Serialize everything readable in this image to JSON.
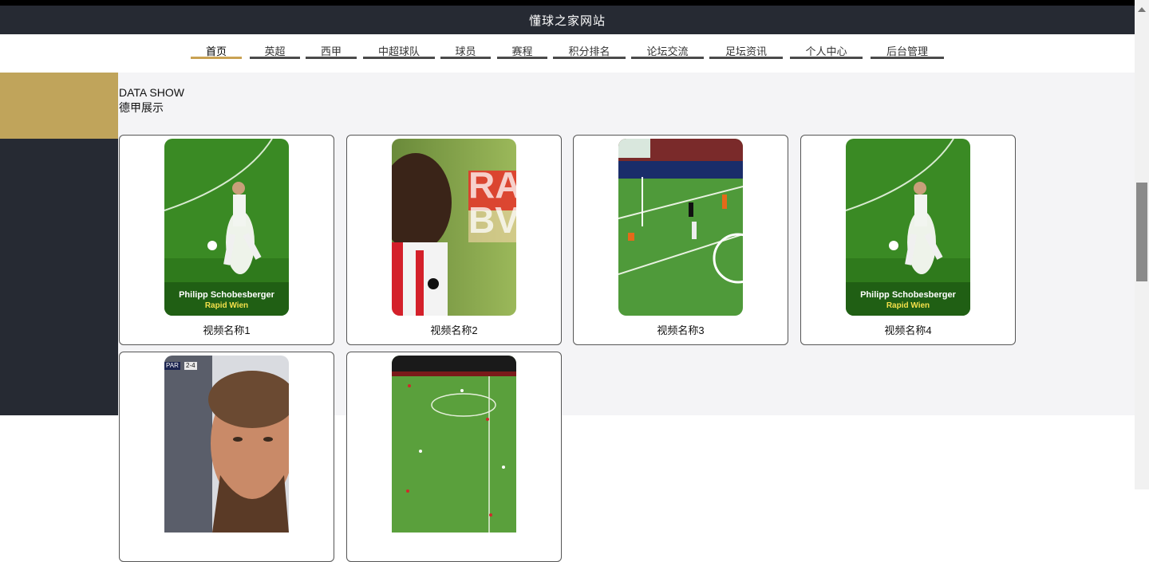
{
  "site_title": "懂球之家网站",
  "nav": [
    {
      "label": "首页",
      "active": true
    },
    {
      "label": "英超"
    },
    {
      "label": "西甲"
    },
    {
      "label": "中超球队"
    },
    {
      "label": "球员"
    },
    {
      "label": "赛程"
    },
    {
      "label": "积分排名"
    },
    {
      "label": "论坛交流"
    },
    {
      "label": "足坛资讯"
    },
    {
      "label": "个人中心"
    },
    {
      "label": "后台管理"
    }
  ],
  "section": {
    "title_en": "DATA SHOW",
    "title_cn": "德甲展示"
  },
  "videos": [
    {
      "caption": "视频名称1",
      "overlay_name": "Philipp Schobesberger",
      "overlay_team": "Rapid Wien"
    },
    {
      "caption": "视频名称2",
      "overlay_text": "RA BV"
    },
    {
      "caption": "视频名称3"
    },
    {
      "caption": "视频名称4",
      "overlay_name": "Philipp Schobesberger",
      "overlay_team": "Rapid Wien"
    },
    {
      "caption": "",
      "scoreboard": "PAR",
      "scoreboard_score": "2-4"
    },
    {
      "caption": ""
    }
  ],
  "colors": {
    "header": "#262a33",
    "accent_gold": "#c0a45b",
    "nav_active": "#c9a253",
    "content_bg": "#f4f4f6"
  }
}
